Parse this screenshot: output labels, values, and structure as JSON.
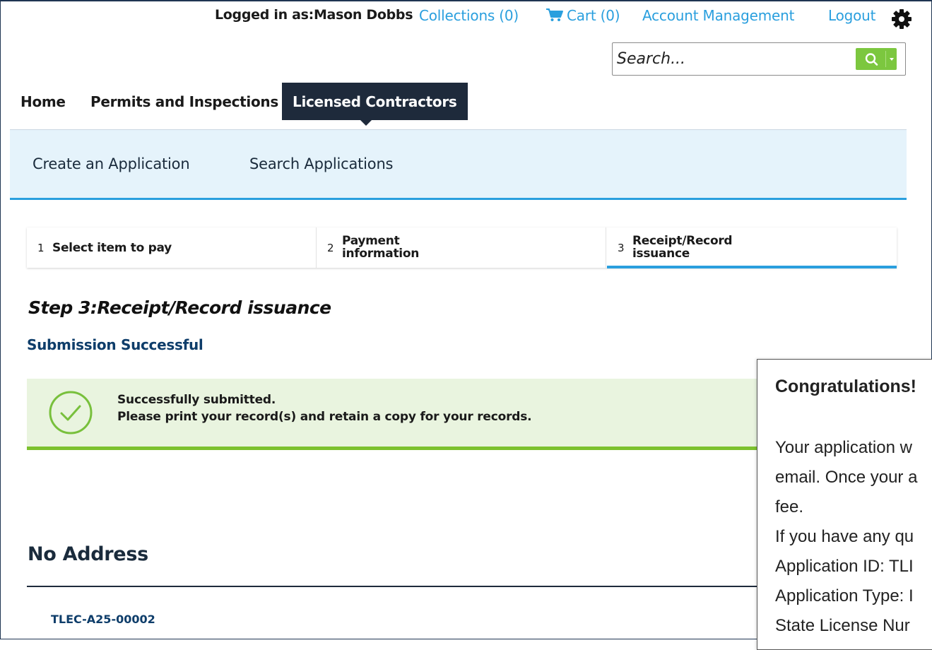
{
  "header": {
    "logged_in": "Logged in as:Mason Dobbs",
    "collections": "Collections (0)",
    "cart": "Cart (0)",
    "account": "Account Management",
    "logout": "Logout",
    "settings_icon": "gear-icon"
  },
  "search": {
    "placeholder": "Search..."
  },
  "nav": {
    "items": [
      "Home",
      "Permits and Inspections",
      "Licensed Contractors"
    ],
    "active": "Licensed Contractors"
  },
  "subnav": {
    "items": [
      "Create an Application",
      "Search Applications"
    ]
  },
  "steps": [
    {
      "num": "1",
      "label": "Select item to pay"
    },
    {
      "num": "2",
      "label_line1": "Payment",
      "label_line2": "information"
    },
    {
      "num": "3",
      "label_line1": "Receipt/Record",
      "label_line2": "issuance"
    }
  ],
  "page": {
    "step_heading": "Step 3:Receipt/Record issuance",
    "submission_title": "Submission Successful",
    "success_line1": "Successfully submitted.",
    "success_line2": "Please print your record(s) and retain a copy for your records.",
    "address_heading": "No Address",
    "record_id": "TLEC-A25-00002"
  },
  "popup": {
    "title": "Congratulations!",
    "lines": [
      "Your application w",
      "email. Once your a",
      "fee.",
      "If you have any qu",
      "Application ID: TLI",
      "Application Type: I",
      "State License Nur"
    ]
  },
  "colors": {
    "accent": "#2a9fde",
    "nav_active": "#1e2a3b",
    "success": "#7cc12e",
    "search_button": "#7cc73f"
  }
}
